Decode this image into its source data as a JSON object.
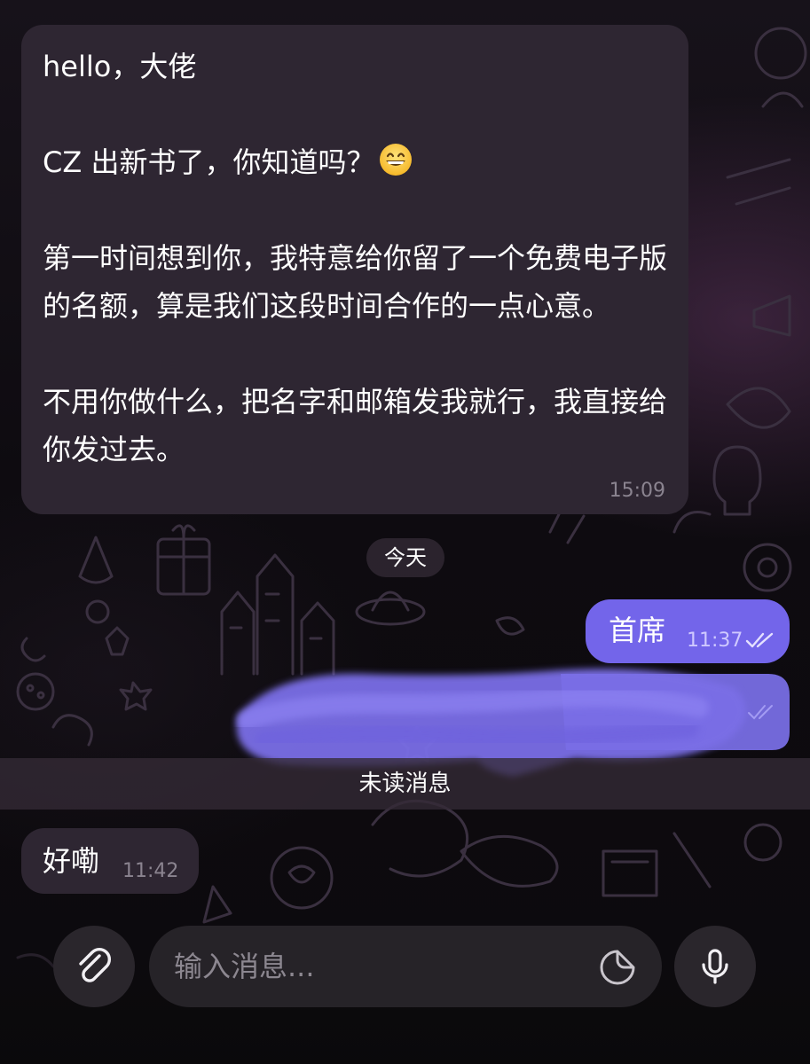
{
  "messages": {
    "incoming_1": {
      "line1": "hello，大佬",
      "line2": "CZ 出新书了，你知道吗？",
      "line3": "第一时间想到你，我特意给你留了一个免费电子版的名额，算是我们这段时间合作的一点心意。",
      "line4": "不用你做什么，把名字和邮箱发我就行，我直接给你发过去。",
      "time": "15:09",
      "emoji": "grinning-face-emoji"
    },
    "date_separator": "今天",
    "outgoing_1": {
      "text": "首席",
      "time": "11:37",
      "status": "read"
    },
    "outgoing_2": {
      "redacted": true,
      "status": "read"
    },
    "unread_label": "未读消息",
    "incoming_2": {
      "text": "好嘞",
      "time": "11:42"
    }
  },
  "composer": {
    "placeholder": "输入消息...",
    "attach_icon": "paperclip-icon",
    "sticker_icon": "sticker-icon",
    "mic_icon": "microphone-icon"
  },
  "colors": {
    "background": "#0c0a0e",
    "incoming_bubble": "#2e2632",
    "outgoing_bubble": "#7365ea",
    "timestamp": "#8b8490"
  }
}
